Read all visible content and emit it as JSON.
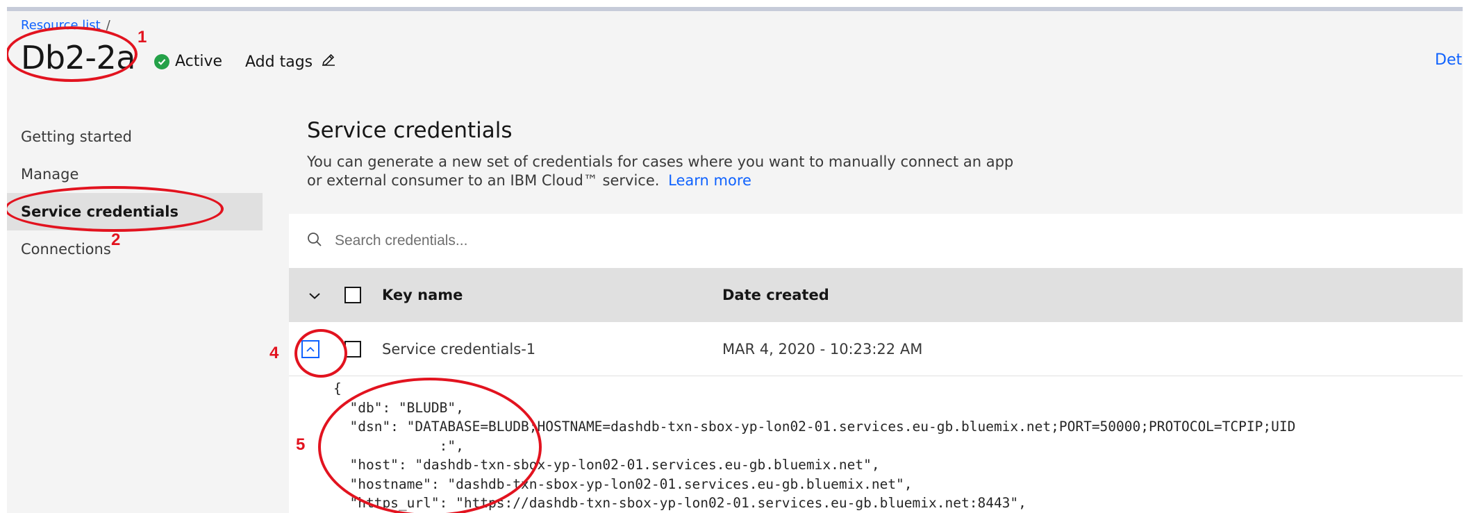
{
  "breadcrumb": {
    "link": "Resource list",
    "separator": "/"
  },
  "header": {
    "title": "Db2-2a",
    "status": "Active",
    "add_tags": "Add tags",
    "details_link": "Deta",
    "status_color": "#24a148"
  },
  "sidenav": {
    "items": [
      {
        "label": "Getting started"
      },
      {
        "label": "Manage"
      },
      {
        "label": "Service credentials"
      },
      {
        "label": "Connections"
      }
    ]
  },
  "section": {
    "title": "Service credentials",
    "description_line1": "You can generate a new set of credentials for cases where you want to manually connect an app",
    "description_line2": "or external consumer to an IBM Cloud™ service.",
    "learn_more": "Learn more"
  },
  "search": {
    "placeholder": "Search credentials..."
  },
  "table": {
    "columns": {
      "key_name": "Key name",
      "date_created": "Date created"
    },
    "rows": [
      {
        "key_name": "Service credentials-1",
        "date_created": "MAR 4, 2020 - 10:23:22 AM"
      }
    ]
  },
  "credentials_json": [
    "{",
    "  \"db\": \"BLUDB\",",
    "  \"dsn\": \"DATABASE=BLUDB;HOSTNAME=dashdb-txn-sbox-yp-lon02-01.services.eu-gb.bluemix.net;PORT=50000;PROTOCOL=TCPIP;UID",
    "             :\",",
    "  \"host\": \"dashdb-txn-sbox-yp-lon02-01.services.eu-gb.bluemix.net\",",
    "  \"hostname\": \"dashdb-txn-sbox-yp-lon02-01.services.eu-gb.bluemix.net\",",
    "  \"https_url\": \"https://dashdb-txn-sbox-yp-lon02-01.services.eu-gb.bluemix.net:8443\","
  ],
  "annotations": {
    "one": "1",
    "two": "2",
    "four": "4",
    "five": "5",
    "color": "#e2131f"
  },
  "colors": {
    "accent": "#0f62fe",
    "nav_active_bg": "#e0e0e0",
    "page_bg": "#f4f4f4"
  }
}
